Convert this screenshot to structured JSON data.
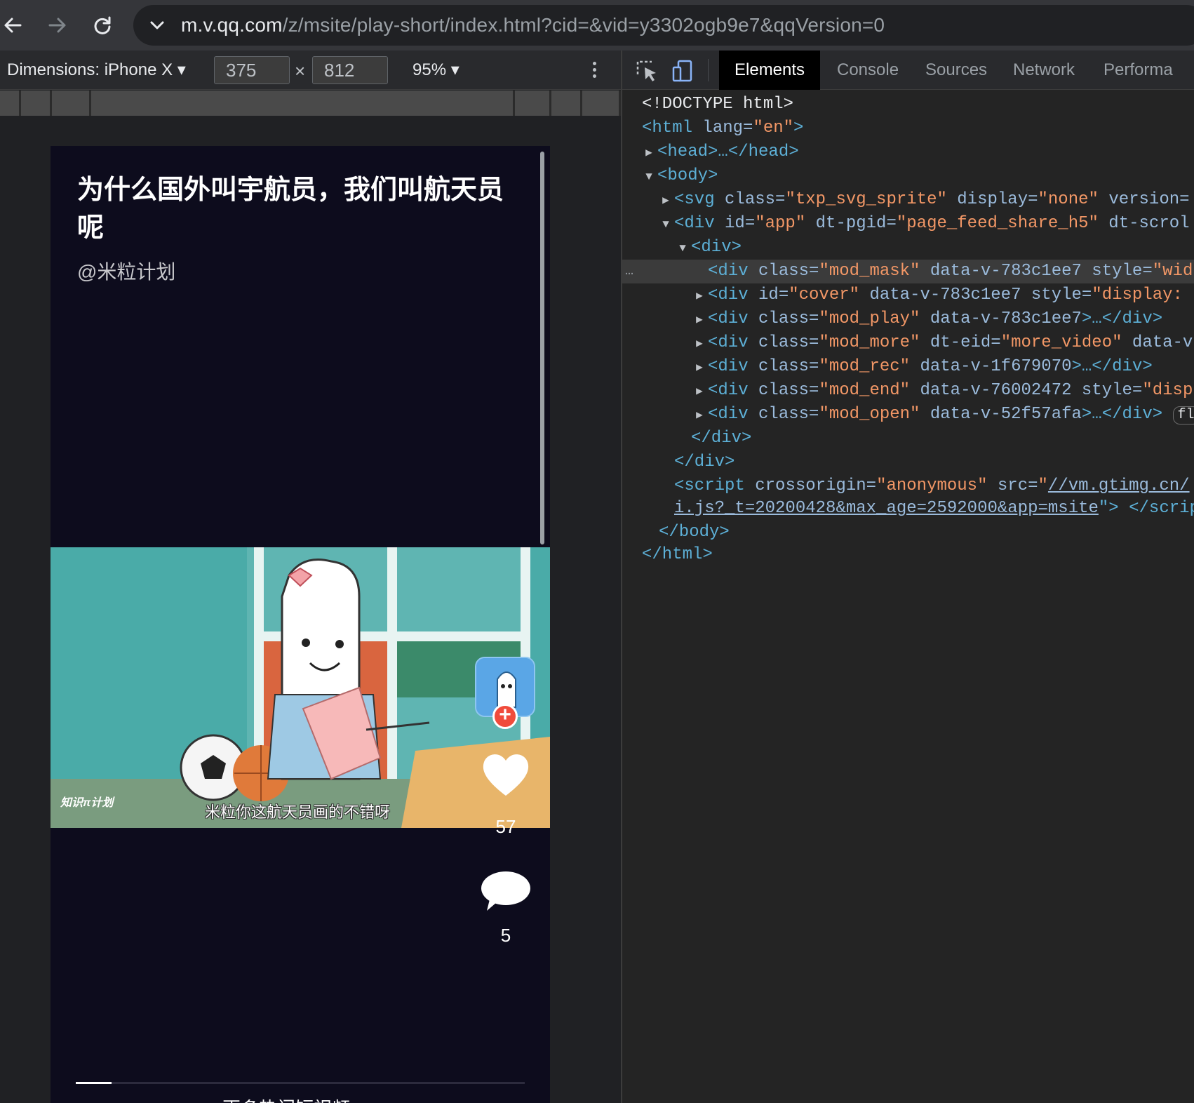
{
  "browser": {
    "url_host": "m.v.qq.com",
    "url_path": "/z/msite/play-short/index.html?cid=&vid=y3302ogb9e7&qqVersion=0"
  },
  "device_toolbar": {
    "dimensions_label": "Dimensions: iPhone X ▾",
    "width": "375",
    "times": "×",
    "height": "812",
    "zoom": "95% ▾"
  },
  "devtools": {
    "tabs": [
      "Elements",
      "Console",
      "Sources",
      "Network",
      "Performa"
    ],
    "active_tab": "Elements",
    "dom": {
      "l1_doctype": "<!DOCTYPE html>",
      "l2_open": "<html",
      "l2_attr": " lang=",
      "l2_val": "\"en\"",
      "l2_close": ">",
      "l3_head": "<head>…</head>",
      "l4_body": "<body>",
      "l5_tag": "<svg",
      "l5_a1": " class=",
      "l5_v1": "\"txp_svg_sprite\"",
      "l5_a2": " display=",
      "l5_v2": "\"none\"",
      "l5_a3": " version=",
      "l6_tag": "<div",
      "l6_a1": " id=",
      "l6_v1": "\"app\"",
      "l6_a2": " dt-pgid=",
      "l6_v2": "\"page_feed_share_h5\"",
      "l6_a3": " dt-scrol",
      "l7_div": "<div>",
      "l8_tag": "<div",
      "l8_a1": " class=",
      "l8_v1": "\"mod_mask\"",
      "l8_a2": " data-v-783c1ee7 style=",
      "l8_v2": "\"wid",
      "l9_tag": "<div",
      "l9_a1": " id=",
      "l9_v1": "\"cover\"",
      "l9_a2": " data-v-783c1ee7 style=",
      "l9_v2": "\"display:",
      "l10_tag": "<div",
      "l10_a1": " class=",
      "l10_v1": "\"mod_play\"",
      "l10_a2": " data-v-783c1ee7",
      "l10_end": ">…</div>",
      "l11_tag": "<div",
      "l11_a1": " class=",
      "l11_v1": "\"mod_more\"",
      "l11_a2": " dt-eid=",
      "l11_v2": "\"more_video\"",
      "l11_a3": " data-v",
      "l12_tag": "<div",
      "l12_a1": " class=",
      "l12_v1": "\"mod_rec\"",
      "l12_a2": " data-v-1f679070",
      "l12_end": ">…</div>",
      "l13_tag": "<div",
      "l13_a1": " class=",
      "l13_v1": "\"mod_end\"",
      "l13_a2": " data-v-76002472 style=",
      "l13_v2": "\"disp",
      "l14_tag": "<div",
      "l14_a1": " class=",
      "l14_v1": "\"mod_open\"",
      "l14_a2": " data-v-52f57afa",
      "l14_end": ">…</div>",
      "l14_badge": "fl",
      "l15_close": "</div>",
      "l16_close": "</div>",
      "l17_tag": "<script",
      "l17_a1": " crossorigin=",
      "l17_v1": "\"anonymous\"",
      "l17_a2": " src=",
      "l17_q": "\"",
      "l17_link": "//vm.gtimg.cn/",
      "l18_link": "i.js?_t=20200428&max_age=2592000&app=msite",
      "l18_rest": "\"> </scrip",
      "l19_close": "</body>",
      "l20_close": "</html>",
      "ellipsis": "…"
    }
  },
  "phone": {
    "title": "为什么国外叫宇航员，我们叫航天员呢",
    "author": "@米粒计划",
    "video_subtitle": "米粒你这航天员画的不错呀",
    "watermark": "知识π计划",
    "like_count": "57",
    "comment_count": "5",
    "follow_plus": "+",
    "progress": 0.08,
    "more_link": "更多热门短视频 >"
  },
  "colors": {
    "phone_bg": "#0d0c1d",
    "video_teal": "#4aaba8",
    "follow_red": "#f04b3c"
  },
  "icons": [
    "back-arrow-icon",
    "forward-arrow-icon",
    "reload-icon",
    "chevron-down-icon",
    "inspect-element-icon",
    "device-toggle-icon",
    "heart-icon",
    "comment-bubble-icon",
    "plus-icon"
  ]
}
